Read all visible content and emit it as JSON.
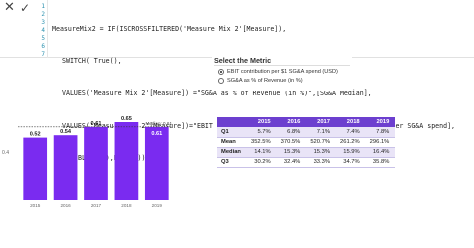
{
  "editor": {
    "line_numbers": [
      "1",
      "2",
      "3",
      "4",
      "5",
      "6",
      "7"
    ],
    "lines": [
      "MeasureMix2 = IF(ISCROSSFILTERED('Measure Mix 2'[Measure]),",
      "SWITCH( True(),",
      "VALUES('Measure Mix 2'[Measure]) =\"SG&A as % of Revenue (in %)\",[SG&A Median],",
      "VALUES('Measure Mix 2'[Measure])=\"EBIT contribution per $1 SG&A spend (USD)\",[EBIT per SG&A spend],",
      "BLANK()),BLANK())"
    ]
  },
  "slicer": {
    "title": "Select the Metric",
    "options": [
      {
        "label": "EBIT contribution per $1 SG&A spend (USD)",
        "selected": true
      },
      {
        "label": "SG&A as % of Revenue (in %)",
        "selected": false
      }
    ]
  },
  "chart_data": {
    "type": "bar",
    "categories": [
      "2015",
      "2016",
      "2017",
      "2018",
      "2019"
    ],
    "values": [
      0.52,
      0.54,
      0.61,
      0.65,
      0.61
    ],
    "data_labels": [
      "0.52",
      "0.54",
      "0.61",
      "0.65",
      "0.61"
    ],
    "ytick": "0.4",
    "reference_line": {
      "label": "Median: 0.61",
      "value": 0.61
    },
    "bar_color": "#7a2bf0",
    "ylim": [
      0,
      0.7
    ]
  },
  "table": {
    "headers": [
      "",
      "2015",
      "2016",
      "2017",
      "2018",
      "2019"
    ],
    "rows": [
      [
        "Q1",
        "5.7%",
        "6.8%",
        "7.1%",
        "7.4%",
        "7.8%"
      ],
      [
        "Mean",
        "352.5%",
        "370.5%",
        "520.7%",
        "261.2%",
        "296.1%"
      ],
      [
        "Median",
        "14.1%",
        "15.3%",
        "15.3%",
        "15.9%",
        "16.4%"
      ],
      [
        "Q3",
        "30.2%",
        "32.4%",
        "33.3%",
        "34.7%",
        "35.8%"
      ]
    ]
  }
}
